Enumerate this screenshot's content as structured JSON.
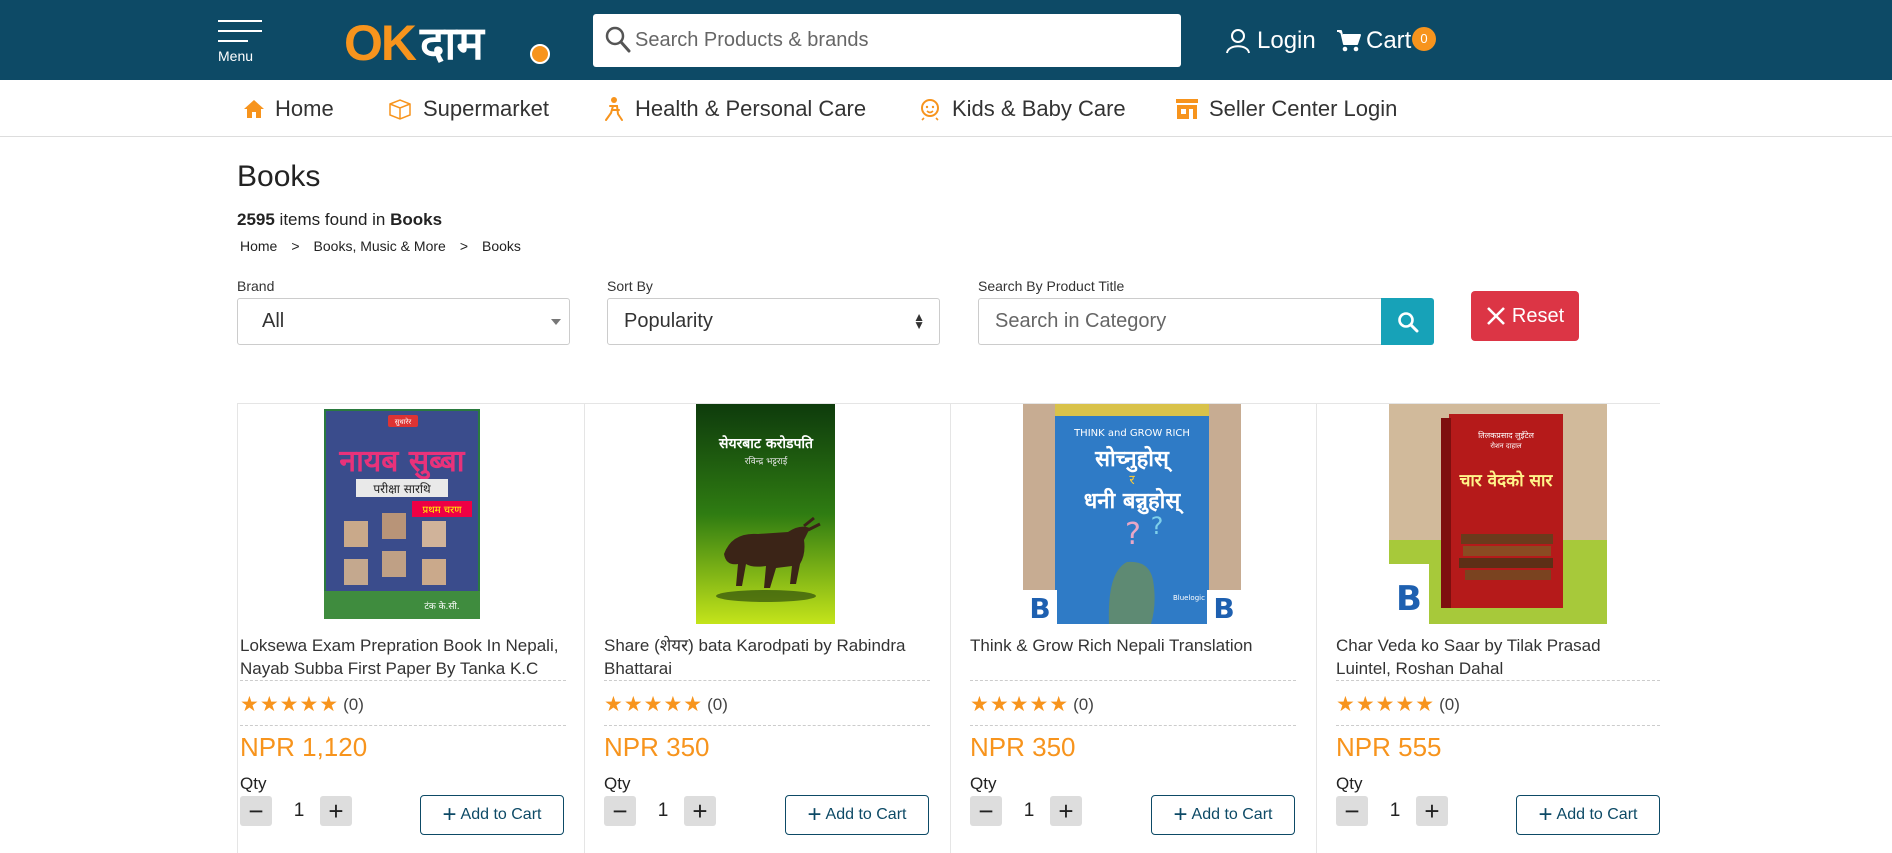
{
  "header": {
    "menu_label": "Menu",
    "logo_ok": "OK",
    "logo_dam": "दाम",
    "search_placeholder": "Search Products & brands",
    "login_label": "Login",
    "cart_label": "Cart",
    "cart_count": "0"
  },
  "nav": [
    {
      "label": "Home",
      "icon": "home-icon"
    },
    {
      "label": "Supermarket",
      "icon": "box-icon"
    },
    {
      "label": "Health & Personal Care",
      "icon": "person-icon"
    },
    {
      "label": "Kids & Baby Care",
      "icon": "baby-icon"
    },
    {
      "label": "Seller Center Login",
      "icon": "store-icon"
    }
  ],
  "page": {
    "title": "Books",
    "count": "2595",
    "count_text": " items found in ",
    "category": "Books",
    "breadcrumb": [
      "Home",
      ">",
      "Books, Music & More",
      ">",
      "Books"
    ]
  },
  "filters": {
    "brand_label": "Brand",
    "brand_value": "All",
    "sort_label": "Sort By",
    "sort_value": "Popularity",
    "title_label": "Search By Product Title",
    "title_placeholder": "Search in Category",
    "reset_label": "Reset"
  },
  "products": [
    {
      "title": "Loksewa Exam Prepration Book In Nepali, Nayab Subba First Paper By Tanka K.C",
      "stars": "★★★★★",
      "reviews": "(0)",
      "price": "NPR 1,120",
      "qty_label": "Qty",
      "qty": "1",
      "add_label": "Add to Cart",
      "cover_title": "नायब सुब्बा",
      "cover_sub": "परीक्षा सारथि",
      "cover_tag": "प्रथम चरण",
      "cover_top": "सुधारेर",
      "cover_author": "टंक के.सी."
    },
    {
      "title": "Share (शेयर) bata Karodpati by Rabindra Bhattarai",
      "stars": "★★★★★",
      "reviews": "(0)",
      "price": "NPR 350",
      "qty_label": "Qty",
      "qty": "1",
      "add_label": "Add to Cart",
      "cover_title": "सेयरबाट करोडपति",
      "cover_sub": "रविन्द्र भट्टराई"
    },
    {
      "title": "Think & Grow Rich Nepali Translation",
      "stars": "★★★★★",
      "reviews": "(0)",
      "price": "NPR 350",
      "qty_label": "Qty",
      "qty": "1",
      "add_label": "Add to Cart",
      "cover_top": "THINK and GROW RICH",
      "cover_title": "सोच्नुहोस्",
      "cover_mid": "र",
      "cover_title2": "धनी बन्नुहोस्",
      "cover_pub": "Bluelogic"
    },
    {
      "title": "Char Veda ko Saar by Tilak Prasad Luintel, Roshan Dahal",
      "stars": "★★★★★",
      "reviews": "(0)",
      "price": "NPR 555",
      "qty_label": "Qty",
      "qty": "1",
      "add_label": "Add to Cart",
      "cover_title": "चार वेदको सार",
      "cover_author": "तिलकप्रसाद लुइँटेल",
      "cover_author2": "रोशन दाहाल"
    }
  ],
  "colors": {
    "header_bg": "#0d4a66",
    "accent": "#f7941d",
    "search_btn": "#17a2b8",
    "reset_btn": "#dc3545"
  }
}
